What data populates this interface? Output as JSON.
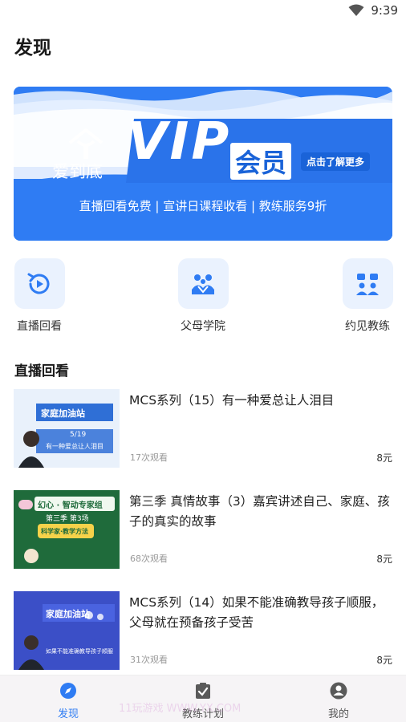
{
  "status_bar": {
    "time": "9:39",
    "icons": [
      "wifi-icon",
      "battery-icon"
    ]
  },
  "page": {
    "title": "发现"
  },
  "banner": {
    "brand_name": "爱到底",
    "vip_text": "VIP",
    "member_text": "会员",
    "more_button": "点击了解更多",
    "benefits": "直播回看免费 | 宣讲日课程收看 | 教练服务9折",
    "colors": {
      "background": "#2f7cf3",
      "accent": "#1a63d8"
    }
  },
  "quick_links": [
    {
      "label": "直播回看",
      "icon": "replay-icon"
    },
    {
      "label": "父母学院",
      "icon": "family-icon"
    },
    {
      "label": "约见教练",
      "icon": "meet-coach-icon"
    }
  ],
  "section": {
    "title": "直播回看"
  },
  "videos": [
    {
      "title": "MCS系列（15）有一种爱总让人泪目",
      "views": "17次观看",
      "price": "8元",
      "thumb": {
        "banner": "家庭加油站",
        "date": "5/19",
        "caption": "有一种爱总让人泪目"
      }
    },
    {
      "title": "第三季 真情故事（3）嘉宾讲述自己、家庭、孩子的真实的故事",
      "views": "68次观看",
      "price": "8元",
      "thumb": {
        "banner": "幻心 · 智动专家组",
        "date": "第三季 第3场",
        "caption": "科学家·教学方法"
      }
    },
    {
      "title": "MCS系列（14）如果不能准确教导孩子顺服，父母就在预备孩子受苦",
      "views": "31次观看",
      "price": "8元",
      "thumb": {
        "banner": "家庭加油站",
        "date": "",
        "caption": "如果不能准确教导孩子顺服"
      }
    }
  ],
  "tabbar": {
    "tabs": [
      {
        "label": "发现",
        "icon": "compass-icon",
        "active": true
      },
      {
        "label": "教练计划",
        "icon": "clipboard-check-icon",
        "active": false
      },
      {
        "label": "我的",
        "icon": "user-icon",
        "active": false
      }
    ]
  },
  "watermark": "11玩游戏 WWW.YX.COM"
}
